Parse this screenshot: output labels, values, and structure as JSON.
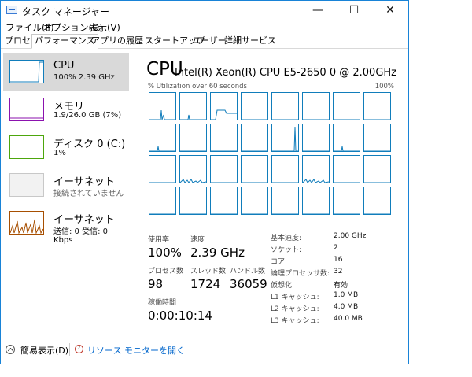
{
  "window": {
    "title": "タスク マネージャー",
    "min": "—",
    "max": "☐",
    "close": "✕"
  },
  "menu": [
    "ファイル(F)",
    "オプション(O)",
    "表示(V)"
  ],
  "tabs": [
    "プロセス",
    "パフォーマンス",
    "アプリの履歴",
    "スタートアップ",
    "ユーザー",
    "詳細",
    "サービス"
  ],
  "sidebar": [
    {
      "title": "CPU",
      "sub": "100%  2.39 GHz",
      "color": "#117dbb"
    },
    {
      "title": "メモリ",
      "sub": "1.9/26.0 GB (7%)",
      "color": "#8b12ae"
    },
    {
      "title": "ディスク 0 (C:)",
      "sub": "1%",
      "color": "#4da60c"
    },
    {
      "title": "イーサネット",
      "sub": "接続されていません",
      "color": "#a0a0a0"
    },
    {
      "title": "イーサネット",
      "sub": "送信: 0 受信: 0 Kbps",
      "color": "#a74f01"
    }
  ],
  "main": {
    "title": "CPU",
    "model": "Intel(R) Xeon(R) CPU E5-2650 0 @ 2.00GHz",
    "util_label": "% Utilization over 60 seconds",
    "util_max": "100%"
  },
  "stats": {
    "usage_label": "使用率",
    "usage": "100%",
    "speed_label": "速度",
    "speed": "2.39 GHz",
    "proc_label": "プロセス数",
    "proc": "98",
    "thread_label": "スレッド数",
    "thread": "1724",
    "handle_label": "ハンドル数",
    "handle": "36059",
    "uptime_label": "稼働時間",
    "uptime": "0:00:10:14"
  },
  "info": [
    {
      "label": "基本速度:",
      "value": "2.00 GHz"
    },
    {
      "label": "ソケット:",
      "value": "2"
    },
    {
      "label": "コア:",
      "value": "16"
    },
    {
      "label": "論理プロセッサ数:",
      "value": "32"
    },
    {
      "label": "仮想化:",
      "value": "有効"
    },
    {
      "label": "L1 キャッシュ:",
      "value": "1.0 MB"
    },
    {
      "label": "L2 キャッシュ:",
      "value": "4.0 MB"
    },
    {
      "label": "L3 キャッシュ:",
      "value": "40.0 MB"
    }
  ],
  "footer": {
    "simple": "簡易表示(D)",
    "link": "リソース モニターを開く"
  },
  "colors": {
    "cpu_line": "#117dbb",
    "accent_border": "#1883d7",
    "link": "#0066cc"
  }
}
